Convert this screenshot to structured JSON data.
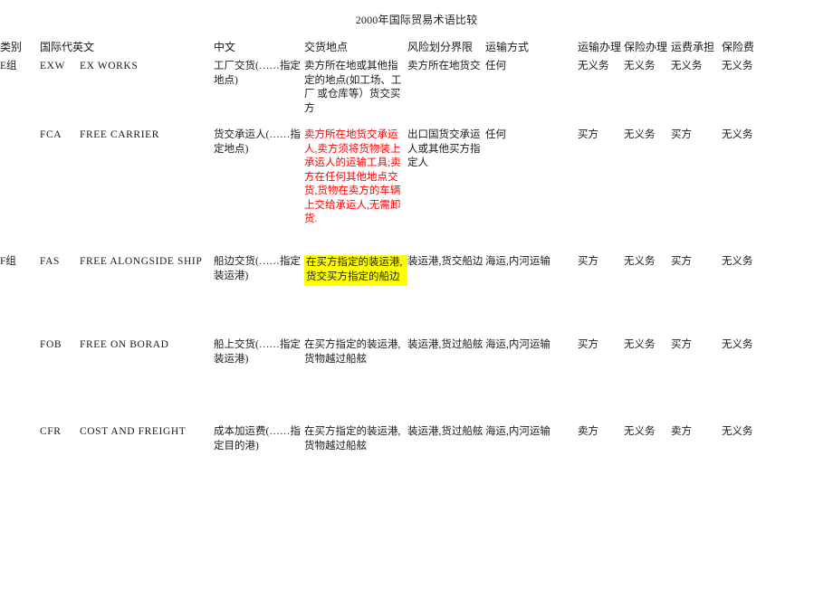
{
  "document": {
    "title": "2000年国际贸易术语比较"
  },
  "table": {
    "columns": [
      {
        "key": "category",
        "label": "类别"
      },
      {
        "key": "code",
        "label": "国际代英文"
      },
      {
        "key": "english",
        "label": ""
      },
      {
        "key": "chinese",
        "label": "中文"
      },
      {
        "key": "delivery_place",
        "label": "交货地点"
      },
      {
        "key": "risk_boundary",
        "label": "风险划分界限"
      },
      {
        "key": "transport_mode",
        "label": "运输方式"
      },
      {
        "key": "shipping_arrangement",
        "label": "运输办理"
      },
      {
        "key": "insurance_arrangement",
        "label": "保险办理"
      },
      {
        "key": "freight_burden",
        "label": "运费承担"
      },
      {
        "key": "insurance_premium",
        "label": "保险费"
      }
    ],
    "groups": [
      {
        "name": "E组"
      },
      {
        "name": "F组"
      }
    ],
    "rows": [
      {
        "group": "E组",
        "code": "EXW",
        "english": "EX WORKS",
        "chinese": "工厂交货(……指定地点)",
        "delivery_place": "卖方所在地或其他指定的地点(如工场、工厂 或仓库等）货交买方",
        "risk_boundary": "卖方所在地货交",
        "transport_mode": "任何",
        "shipping_arrangement": "无义务",
        "insurance_arrangement": "无义务",
        "freight_burden": "无义务",
        "insurance_premium": "无义务",
        "delivery_place_style": "normal"
      },
      {
        "group": "F组",
        "code": "FCA",
        "english": "FREE CARRIER",
        "chinese": "货交承运人(……指定地点)",
        "delivery_place": "卖方所在地货交承运人,卖方须将货物装上承运人的运输工具;卖方在任何其他地点交货,货物在卖方的车辆上交给承运人,无需卸货.",
        "risk_boundary": "出口国货交承运人或其他买方指定人",
        "transport_mode": "任何",
        "shipping_arrangement": "买方",
        "insurance_arrangement": "无义务",
        "freight_burden": "买方",
        "insurance_premium": "无义务",
        "delivery_place_style": "red"
      },
      {
        "group": "F组",
        "code": "FAS",
        "english": "FREE ALONGSIDE SHIP",
        "chinese": "船边交货(……指定装运港)",
        "delivery_place": "在买方指定的装运港,货交买方指定的船边",
        "risk_boundary": "装运港,货交船边",
        "transport_mode": "海运,内河运输",
        "shipping_arrangement": "买方",
        "insurance_arrangement": "无义务",
        "freight_burden": "买方",
        "insurance_premium": "无义务",
        "delivery_place_style": "highlight"
      },
      {
        "group": "F组",
        "code": "FOB",
        "english": "FREE ON BORAD",
        "chinese": "船上交货(……指定装运港)",
        "delivery_place": "在买方指定的装运港,货物越过船舷",
        "risk_boundary": "装运港,货过船舷",
        "transport_mode": "海运,内河运输",
        "shipping_arrangement": "买方",
        "insurance_arrangement": "无义务",
        "freight_burden": "买方",
        "insurance_premium": "无义务",
        "delivery_place_style": "normal"
      },
      {
        "group": "F组",
        "code": "CFR",
        "english": "COST AND FREIGHT",
        "chinese": "成本加运费(……指定目的港)",
        "delivery_place": "在买方指定的装运港,货物越过船舷",
        "risk_boundary": "装运港,货过船舷",
        "transport_mode": "海运,内河运输",
        "shipping_arrangement": "卖方",
        "insurance_arrangement": "无义务",
        "freight_burden": "卖方",
        "insurance_premium": "无义务",
        "delivery_place_style": "normal"
      }
    ]
  },
  "colors": {
    "emphasis_text": "#ff0000",
    "highlight_background": "#ffff00",
    "body_text": "#1a1a1a",
    "page_background": "#ffffff"
  }
}
